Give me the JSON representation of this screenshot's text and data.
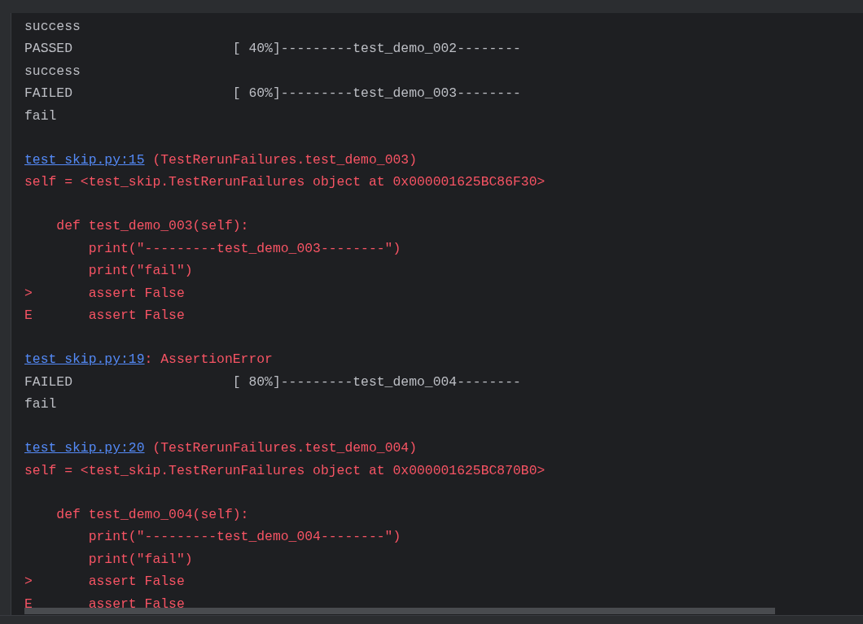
{
  "console": {
    "lines": [
      {
        "kind": "output",
        "text": "success"
      },
      {
        "kind": "result",
        "status": "PASSED",
        "progress": "[ 40%]---------test_demo_002--------"
      },
      {
        "kind": "output",
        "text": "success"
      },
      {
        "kind": "result",
        "status": "FAILED",
        "progress": "[ 60%]---------test_demo_003--------"
      },
      {
        "kind": "output",
        "text": "fail"
      },
      {
        "kind": "blank"
      },
      {
        "kind": "location",
        "link": "test_skip.py:15",
        "text": " (TestRerunFailures.test_demo_003)"
      },
      {
        "kind": "error",
        "text": "self = <test_skip.TestRerunFailures object at 0x000001625BC86F30>"
      },
      {
        "kind": "blank"
      },
      {
        "kind": "error",
        "text": "    def test_demo_003(self):"
      },
      {
        "kind": "error",
        "text": "        print(\"---------test_demo_003--------\")"
      },
      {
        "kind": "error",
        "text": "        print(\"fail\")"
      },
      {
        "kind": "marked",
        "marker": ">",
        "text": "assert False"
      },
      {
        "kind": "marked",
        "marker": "E",
        "text": "assert False"
      },
      {
        "kind": "blank"
      },
      {
        "kind": "location",
        "link": "test_skip.py:19",
        "text": ": AssertionError"
      },
      {
        "kind": "result",
        "status": "FAILED",
        "progress": "[ 80%]---------test_demo_004--------"
      },
      {
        "kind": "output",
        "text": "fail"
      },
      {
        "kind": "blank"
      },
      {
        "kind": "location",
        "link": "test_skip.py:20",
        "text": " (TestRerunFailures.test_demo_004)"
      },
      {
        "kind": "error",
        "text": "self = <test_skip.TestRerunFailures object at 0x000001625BC870B0>"
      },
      {
        "kind": "blank"
      },
      {
        "kind": "error",
        "text": "    def test_demo_004(self):"
      },
      {
        "kind": "error",
        "text": "        print(\"---------test_demo_004--------\")"
      },
      {
        "kind": "error",
        "text": "        print(\"fail\")"
      },
      {
        "kind": "marked",
        "marker": ">",
        "text": "assert False"
      },
      {
        "kind": "marked",
        "marker": "E",
        "text": "assert False"
      }
    ]
  }
}
